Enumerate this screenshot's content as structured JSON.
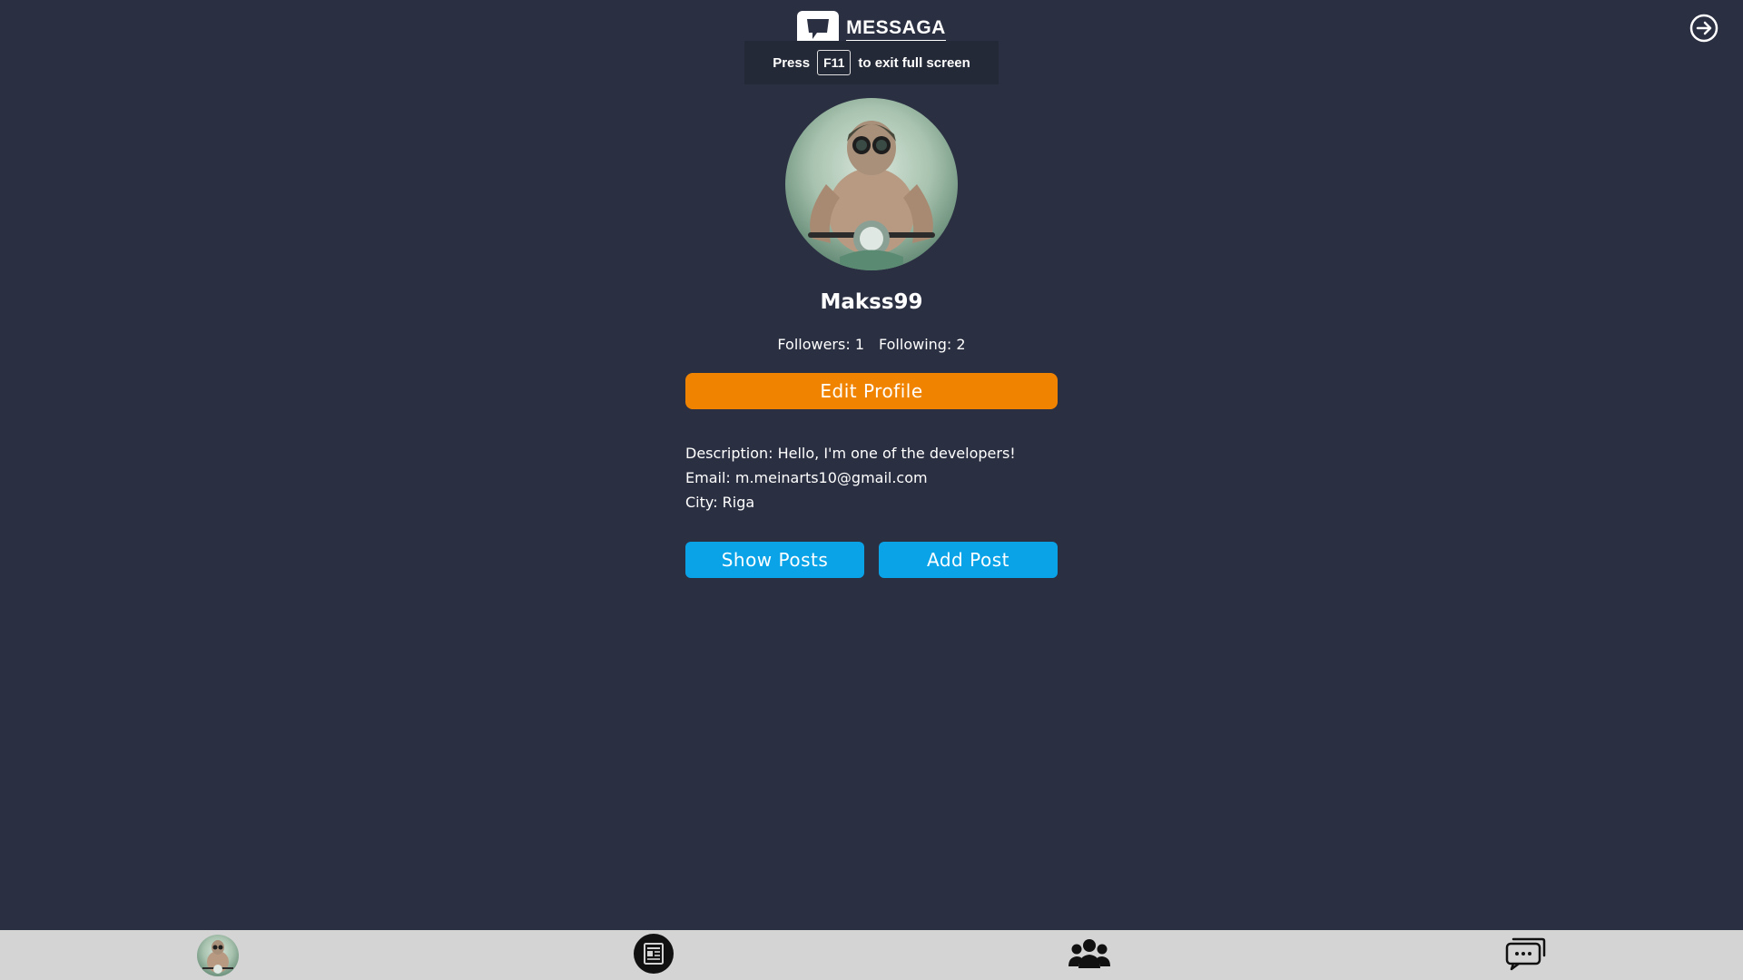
{
  "header": {
    "app_name": "MESSAGA",
    "logo_icon": "chat-bubble-icon",
    "logout_icon": "logout-arrow-icon"
  },
  "fullscreen_hint": {
    "press": "Press",
    "key": "F11",
    "suffix": "to exit full screen"
  },
  "profile": {
    "username": "Makss99",
    "followers": "Followers: 1",
    "following": "Following: 2",
    "edit_label": "Edit Profile",
    "description": "Description: Hello, I'm one of the developers!",
    "email": "Email: m.meinarts10@gmail.com",
    "city": "City: Riga",
    "show_posts_label": "Show Posts",
    "add_post_label": "Add Post"
  },
  "colors": {
    "background": "#2a2f42",
    "accent_orange": "#f08400",
    "accent_blue": "#0aa3e8",
    "nav_bg": "#d4d4d4"
  },
  "bottom_nav": {
    "items": [
      {
        "icon": "profile-avatar-icon"
      },
      {
        "icon": "newspaper-icon"
      },
      {
        "icon": "users-group-icon"
      },
      {
        "icon": "chat-messages-icon"
      }
    ]
  }
}
